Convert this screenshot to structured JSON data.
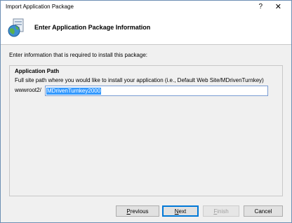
{
  "window": {
    "title": "Import Application Package",
    "help_glyph": "?",
    "close_glyph": "✕"
  },
  "header": {
    "heading": "Enter Application Package Information",
    "icon": "package-globe-icon"
  },
  "instructions": "Enter information that is required to install this package:",
  "group": {
    "label": "Application Path",
    "description": "Full site path where you would like to install your application (i.e., Default Web Site/MDrivenTurnkey)",
    "prefix": "wwwroot2/",
    "input_value": "MDrivenTurnkey2000"
  },
  "buttons": {
    "previous_u": "P",
    "previous_rest": "revious",
    "next_u": "N",
    "next_rest": "ext",
    "finish_u": "F",
    "finish_rest": "inish",
    "cancel": "Cancel"
  },
  "colors": {
    "accent": "#0078d7",
    "selection": "#3399ff",
    "content_bg": "#f0f0f0"
  }
}
